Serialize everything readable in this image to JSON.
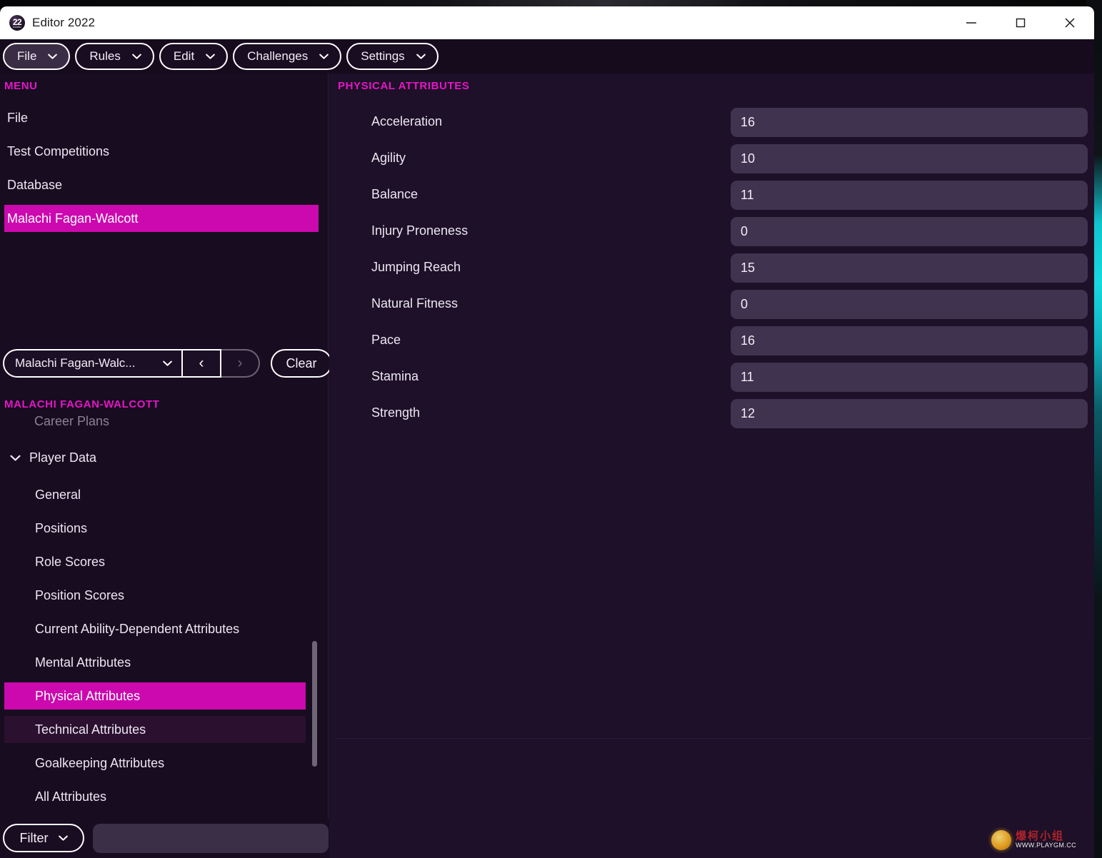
{
  "window": {
    "title": "Editor 2022",
    "icon_label": "22",
    "icon_sub": "FOOTBALL",
    "controls": {
      "minimize": "minimize-icon",
      "maximize": "maximize-icon",
      "close": "close-icon"
    }
  },
  "menubar": {
    "items": [
      {
        "label": "File",
        "active": true
      },
      {
        "label": "Rules",
        "active": false
      },
      {
        "label": "Edit",
        "active": false
      },
      {
        "label": "Challenges",
        "active": false
      },
      {
        "label": "Settings",
        "active": false
      }
    ]
  },
  "sidebar": {
    "menu_heading": "MENU",
    "menu_items": [
      {
        "label": "File",
        "selected": false
      },
      {
        "label": "Test Competitions",
        "selected": false
      },
      {
        "label": "Database",
        "selected": false
      },
      {
        "label": "Malachi Fagan-Walcott",
        "selected": true
      }
    ],
    "selector": {
      "dropdown_value": "Malachi Fagan-Walc...",
      "prev_label": "‹",
      "next_label": "›",
      "clear_label": "Clear"
    },
    "player_heading": "MALACHI FAGAN-WALCOTT",
    "career_plans_label": "Career Plans",
    "player_data_label": "Player Data",
    "tree_items": [
      {
        "label": "General",
        "state": "normal"
      },
      {
        "label": "Positions",
        "state": "normal"
      },
      {
        "label": "Role Scores",
        "state": "normal"
      },
      {
        "label": "Position Scores",
        "state": "normal"
      },
      {
        "label": "Current Ability-Dependent Attributes",
        "state": "normal"
      },
      {
        "label": "Mental Attributes",
        "state": "normal"
      },
      {
        "label": "Physical Attributes",
        "state": "selected"
      },
      {
        "label": "Technical Attributes",
        "state": "hovered"
      },
      {
        "label": "Goalkeeping Attributes",
        "state": "normal"
      },
      {
        "label": "All Attributes",
        "state": "normal"
      }
    ],
    "filter": {
      "button_label": "Filter",
      "input_value": "",
      "input_placeholder": ""
    }
  },
  "main": {
    "heading": "PHYSICAL ATTRIBUTES",
    "attributes": [
      {
        "label": "Acceleration",
        "value": "16"
      },
      {
        "label": "Agility",
        "value": "10"
      },
      {
        "label": "Balance",
        "value": "11"
      },
      {
        "label": "Injury Proneness",
        "value": "0"
      },
      {
        "label": "Jumping Reach",
        "value": "15"
      },
      {
        "label": "Natural Fitness",
        "value": "0"
      },
      {
        "label": "Pace",
        "value": "16"
      },
      {
        "label": "Stamina",
        "value": "11"
      },
      {
        "label": "Strength",
        "value": "12"
      }
    ]
  },
  "watermark": {
    "cn_text": "爆柯小组",
    "url_text": "WWW.PLAYGM.CC"
  },
  "colors": {
    "accent_magenta": "#cc09ae",
    "heading_pink": "#e516c6",
    "window_bg": "#190d22",
    "sidebar_bg": "#170c20",
    "main_bg": "#1d1028",
    "field_bg": "#3f3350",
    "text": "#ece6f2",
    "muted_text": "#8d8096"
  }
}
